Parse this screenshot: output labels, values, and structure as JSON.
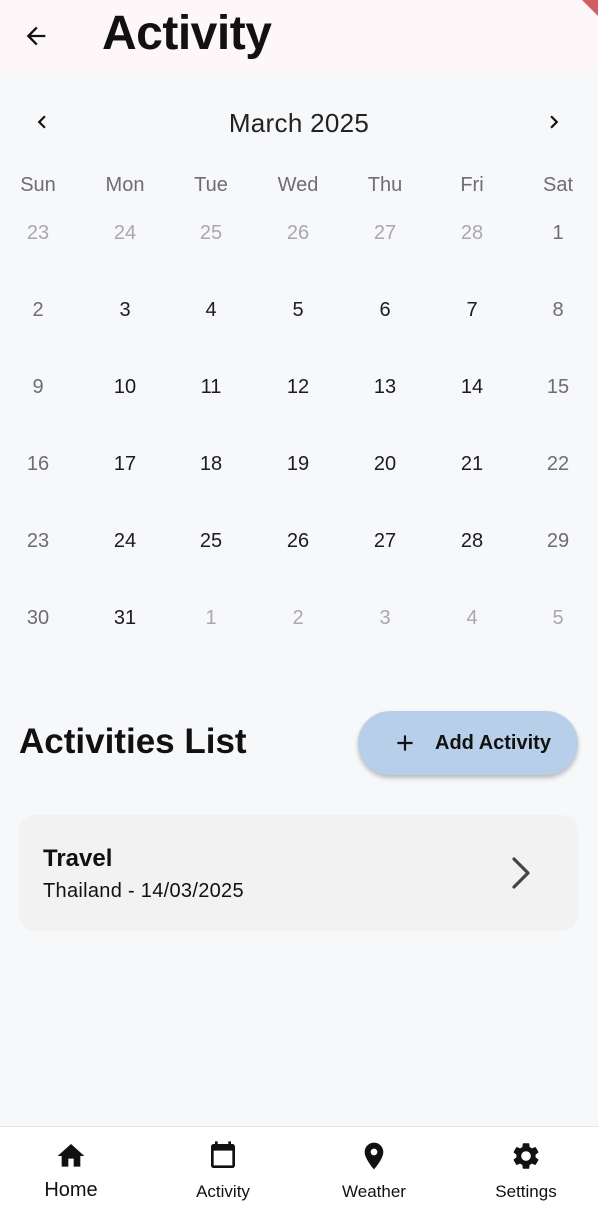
{
  "appbar": {
    "title": "Activity",
    "back_icon": "arrow-left-icon"
  },
  "calendar": {
    "month_label": "March 2025",
    "prev_icon": "chevron-left-icon",
    "next_icon": "chevron-right-icon",
    "weekdays": [
      "Sun",
      "Mon",
      "Tue",
      "Wed",
      "Thu",
      "Fri",
      "Sat"
    ],
    "weeks": [
      [
        {
          "d": "23",
          "out": true
        },
        {
          "d": "24",
          "out": true
        },
        {
          "d": "25",
          "out": true
        },
        {
          "d": "26",
          "out": true
        },
        {
          "d": "27",
          "out": true
        },
        {
          "d": "28",
          "out": true
        },
        {
          "d": "1",
          "out": false
        }
      ],
      [
        {
          "d": "2",
          "out": false
        },
        {
          "d": "3",
          "out": false
        },
        {
          "d": "4",
          "out": false
        },
        {
          "d": "5",
          "out": false
        },
        {
          "d": "6",
          "out": false
        },
        {
          "d": "7",
          "out": false
        },
        {
          "d": "8",
          "out": false
        }
      ],
      [
        {
          "d": "9",
          "out": false
        },
        {
          "d": "10",
          "out": false
        },
        {
          "d": "11",
          "out": false
        },
        {
          "d": "12",
          "out": false
        },
        {
          "d": "13",
          "out": false
        },
        {
          "d": "14",
          "out": false
        },
        {
          "d": "15",
          "out": false
        }
      ],
      [
        {
          "d": "16",
          "out": false
        },
        {
          "d": "17",
          "out": false
        },
        {
          "d": "18",
          "out": false
        },
        {
          "d": "19",
          "out": false
        },
        {
          "d": "20",
          "out": false
        },
        {
          "d": "21",
          "out": false
        },
        {
          "d": "22",
          "out": false
        }
      ],
      [
        {
          "d": "23",
          "out": false
        },
        {
          "d": "24",
          "out": false
        },
        {
          "d": "25",
          "out": false
        },
        {
          "d": "26",
          "out": false
        },
        {
          "d": "27",
          "out": false
        },
        {
          "d": "28",
          "out": false
        },
        {
          "d": "29",
          "out": false
        }
      ],
      [
        {
          "d": "30",
          "out": false
        },
        {
          "d": "31",
          "out": false
        },
        {
          "d": "1",
          "out": true
        },
        {
          "d": "2",
          "out": true
        },
        {
          "d": "3",
          "out": true
        },
        {
          "d": "4",
          "out": true
        },
        {
          "d": "5",
          "out": true
        }
      ]
    ]
  },
  "activities": {
    "section_title": "Activities List",
    "add_button_label": "Add Activity",
    "add_icon": "plus-icon",
    "items": [
      {
        "title": "Travel",
        "subtitle": "Thailand - 14/03/2025",
        "chevron_icon": "chevron-right-icon"
      }
    ]
  },
  "bottom_nav": {
    "items": [
      {
        "label": "Home",
        "icon": "home-icon",
        "active": true
      },
      {
        "label": "Activity",
        "icon": "calendar-icon",
        "active": false
      },
      {
        "label": "Weather",
        "icon": "location-pin-icon",
        "active": false
      },
      {
        "label": "Settings",
        "icon": "gear-icon",
        "active": false
      }
    ]
  },
  "colors": {
    "background": "#f7f8fa",
    "appbar_bg": "#fdf7fa",
    "add_button_bg": "#b7cfe8",
    "card_bg": "#f2f2f3",
    "muted_text": "#a9a9ad",
    "weekend_text": "#6d6d72"
  }
}
